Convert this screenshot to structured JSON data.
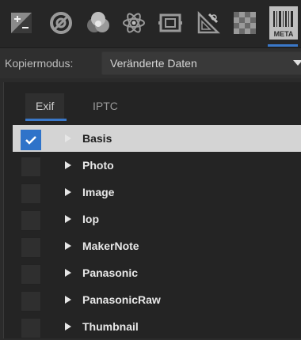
{
  "toolbar": {
    "tools": [
      {
        "icon": "exposure-plus-minus-icon"
      },
      {
        "icon": "lens-correction-icon"
      },
      {
        "icon": "color-circles-icon"
      },
      {
        "icon": "atom-icon"
      },
      {
        "icon": "camera-frame-icon"
      },
      {
        "icon": "triangle-ruler-icon"
      },
      {
        "icon": "checkerboard-icon"
      },
      {
        "icon": "meta-barcode-icon",
        "label": "META"
      }
    ],
    "meta_label": "META",
    "accent": "#3a78c9"
  },
  "copy": {
    "label": "Kopiermodus:",
    "selected": "Veränderte Daten"
  },
  "tabs": [
    {
      "label": "Exif",
      "active": true
    },
    {
      "label": "IPTC",
      "active": false
    }
  ],
  "items": [
    {
      "label": "Basis",
      "checked": true,
      "selected": true
    },
    {
      "label": "Photo",
      "checked": false,
      "selected": false
    },
    {
      "label": "Image",
      "checked": false,
      "selected": false
    },
    {
      "label": "Iop",
      "checked": false,
      "selected": false
    },
    {
      "label": "MakerNote",
      "checked": false,
      "selected": false
    },
    {
      "label": "Panasonic",
      "checked": false,
      "selected": false
    },
    {
      "label": "PanasonicRaw",
      "checked": false,
      "selected": false
    },
    {
      "label": "Thumbnail",
      "checked": false,
      "selected": false
    }
  ]
}
